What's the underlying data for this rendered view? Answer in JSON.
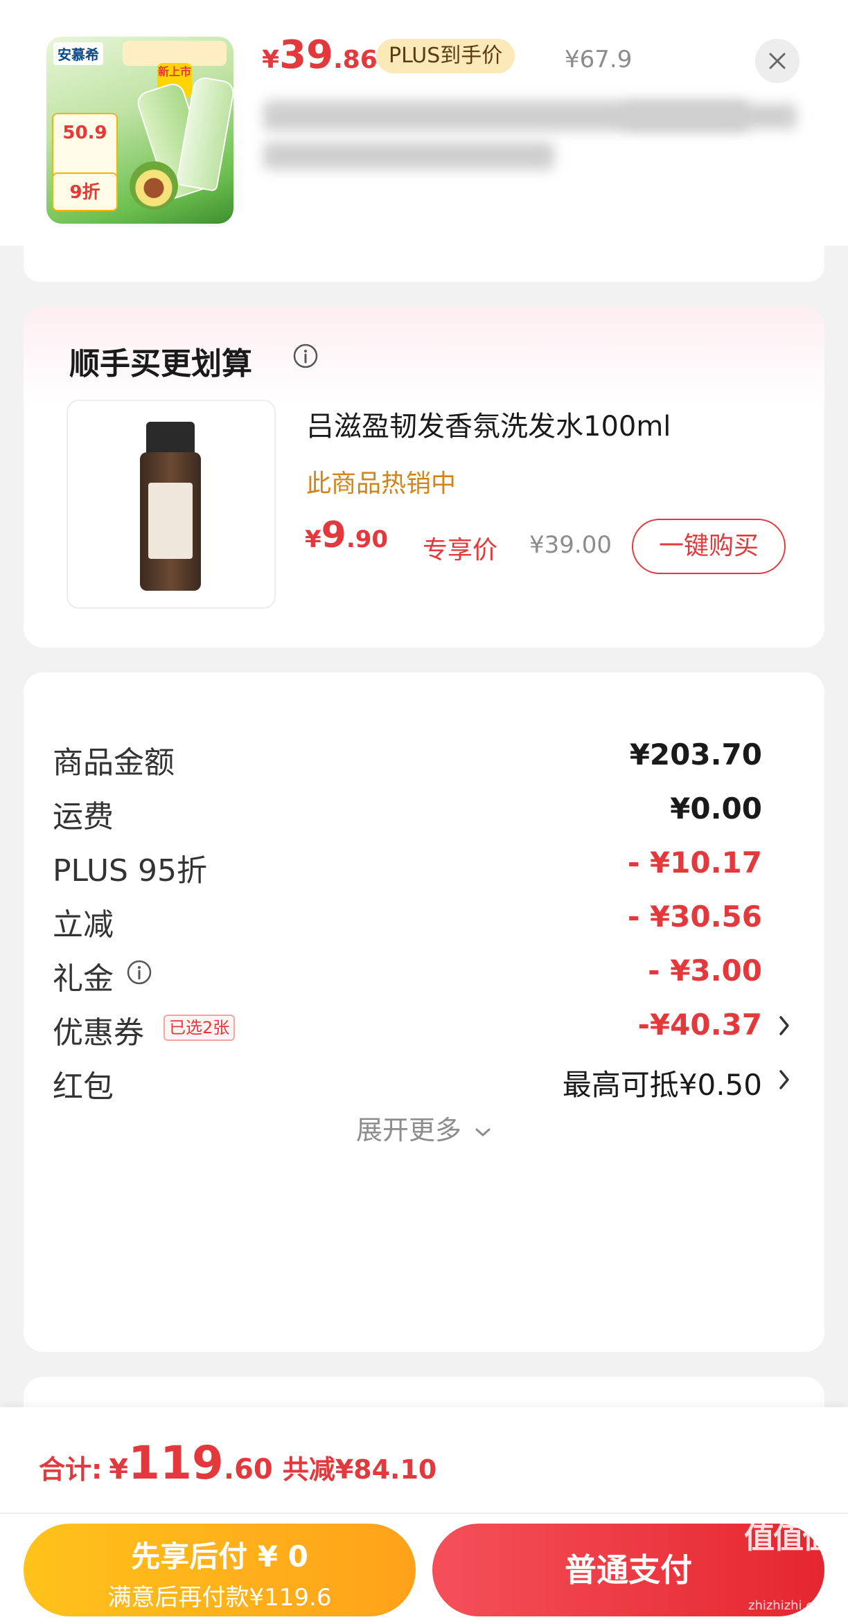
{
  "top_product": {
    "thumb": {
      "brand": "安慕希",
      "sticker_price": "50.9",
      "sticker_discount": "9折",
      "new_badge": "新上市"
    },
    "price_yen": "¥",
    "price_int": "39",
    "price_dec": ".86",
    "plus_tag": "PLUS到手价",
    "old_price": "¥67.9"
  },
  "addon": {
    "title": "顺手买更划算",
    "name": "吕滋盈韧发香氛洗发水100ml",
    "hot": "此商品热销中",
    "price_yen": "¥",
    "price_int": "9",
    "price_dec": ".90",
    "exclusive": "专享价",
    "old_price": "¥39.00",
    "buy_button": "一键购买"
  },
  "summary": {
    "rows": [
      {
        "label": "商品金额",
        "value": "¥203.70"
      },
      {
        "label": "运费",
        "value": "¥0.00"
      },
      {
        "label": "PLUS 95折",
        "value": "- ¥10.17"
      },
      {
        "label": "立减",
        "value": "- ¥30.56"
      },
      {
        "label": "礼金",
        "value": "- ¥3.00"
      },
      {
        "label": "优惠券",
        "value": "-¥40.37",
        "tag": "已选2张"
      },
      {
        "label": "红包",
        "value": "最高可抵¥0.50"
      }
    ],
    "expand": "展开更多"
  },
  "bottom": {
    "total_label": "合计:",
    "total_yen": "¥",
    "total_int": "119",
    "total_dec": ".60",
    "total_saved": "共减¥84.10",
    "pay_later_line1": "先享后付 ¥ 0",
    "pay_later_line2": "满意后再付款¥119.6",
    "pay_normal": "普通支付"
  },
  "watermark": {
    "main": "值值值",
    "sub": "zhizhizhi.com"
  },
  "colors": {
    "accent_red": "#e4393c",
    "gold": "#d0851c",
    "pay_later": "#ffb21a"
  }
}
